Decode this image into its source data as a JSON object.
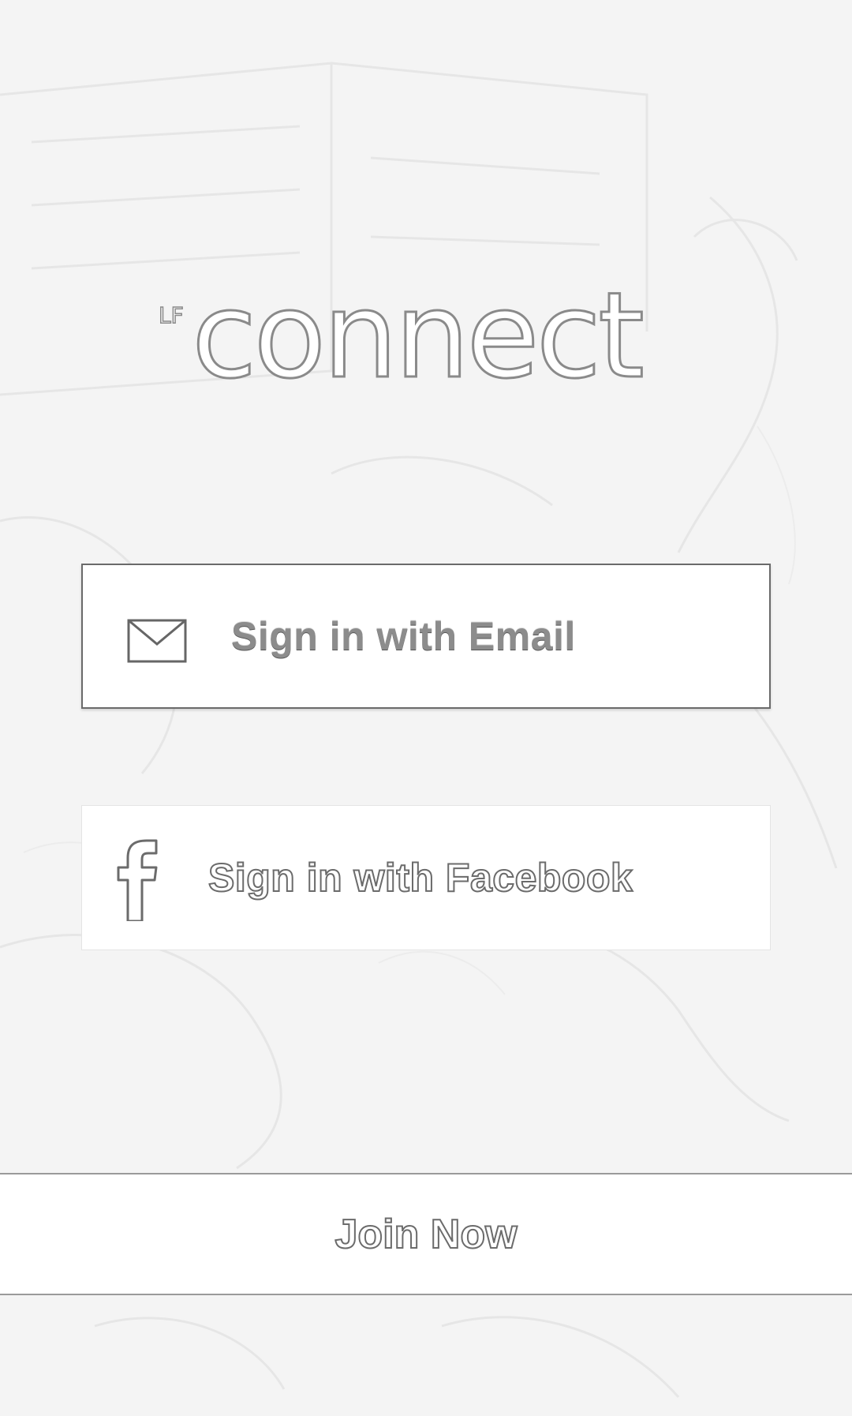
{
  "logo": {
    "prefix": "LF",
    "word": "connect"
  },
  "buttons": {
    "email": {
      "label": "Sign in with Email",
      "icon": "envelope-icon"
    },
    "facebook": {
      "label": "Sign in with Facebook",
      "icon": "facebook-icon"
    },
    "join": {
      "label": "Join Now"
    }
  },
  "colors": {
    "background": "#f5f5f5",
    "button_background": "#ffffff",
    "outline": "#6b6b6b"
  }
}
